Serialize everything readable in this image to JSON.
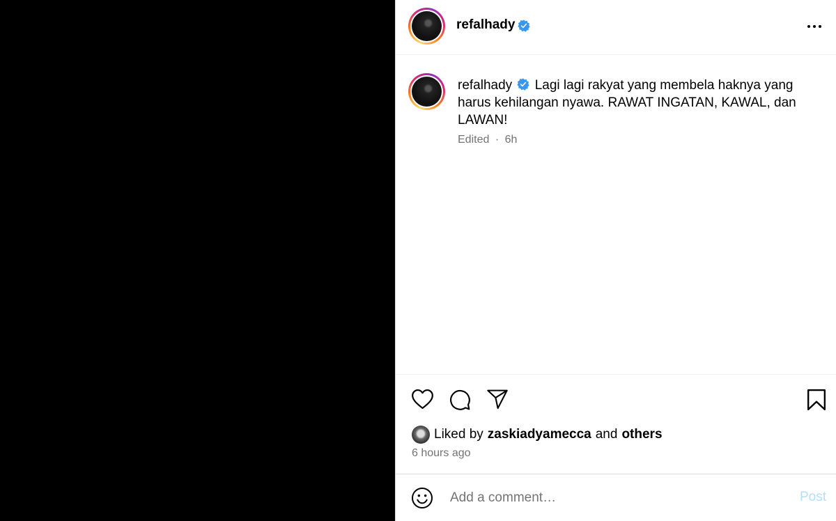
{
  "header": {
    "username": "refalhady",
    "verified": true
  },
  "caption": {
    "username": "refalhady",
    "text": "Lagi lagi rakyat yang membela haknya yang harus kehilangan nyawa. RAWAT INGATAN, KAWAL, dan LAWAN!",
    "edited": "Edited",
    "separator": "·",
    "time": "6h"
  },
  "likes": {
    "prefix": "Liked by",
    "user": "zaskiadyamecca",
    "conjunction": "and",
    "others": "others"
  },
  "timestamp": "6 hours ago",
  "comment": {
    "placeholder": "Add a comment…",
    "post_label": "Post"
  },
  "colors": {
    "verified": "#3897f0",
    "post_disabled": "#b2dffc",
    "secondary_text": "#737373"
  },
  "icons": [
    "more-icon",
    "verified-icon",
    "heart-icon",
    "comment-icon",
    "share-icon",
    "bookmark-icon",
    "emoji-icon"
  ]
}
